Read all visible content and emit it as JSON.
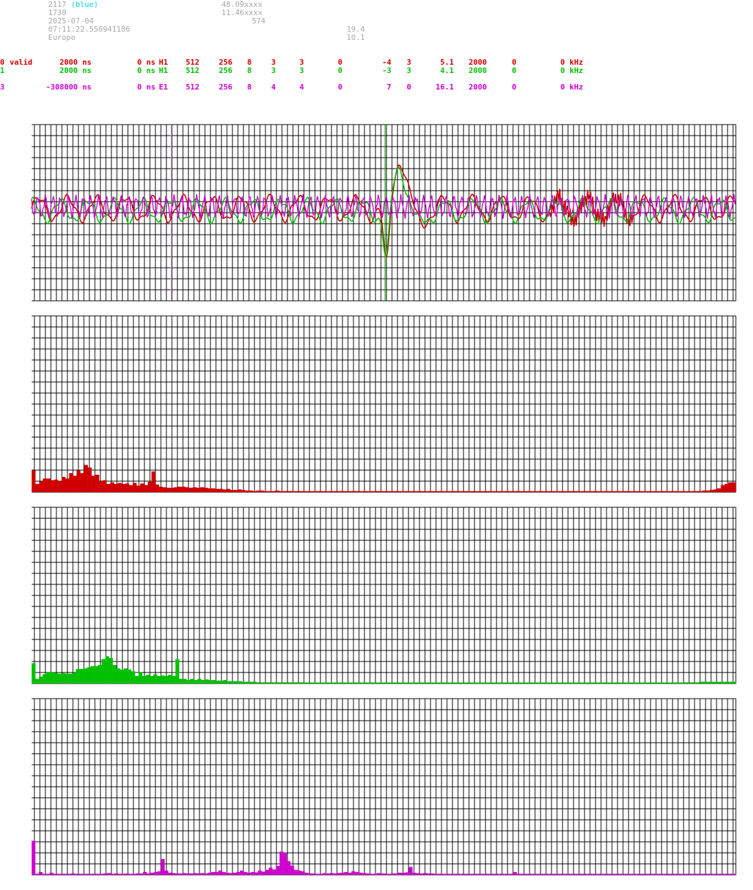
{
  "header": {
    "station_id": "2117",
    "station_color": "(blue)",
    "line2": "1730",
    "date": "2025-07-04",
    "time": "07:11:22.556941186",
    "region": "Europe",
    "lat": "48.09xxxx",
    "lon": "11.46xxxx",
    "alt": "574",
    "val1": "19.4",
    "val2": "10.1"
  },
  "channels": [
    {
      "id": "0",
      "flag": "valid",
      "offset": "2000 ns",
      "delay": "0 ns",
      "type": "H1",
      "c1": "512",
      "c2": "256",
      "c3": "8",
      "c4": "3",
      "c5": "3",
      "c6": "0",
      "c7": "-4",
      "c8": "3",
      "c9": "5.1",
      "c10": "2000",
      "c11": "0",
      "freq": "0 kHz",
      "color": "#d00000"
    },
    {
      "id": "1",
      "flag": "",
      "offset": "2000 ns",
      "delay": "0 ns",
      "type": "H1",
      "c1": "512",
      "c2": "256",
      "c3": "8",
      "c4": "3",
      "c5": "3",
      "c6": "0",
      "c7": "-3",
      "c8": "3",
      "c9": "4.1",
      "c10": "2000",
      "c11": "0",
      "freq": "0 kHz",
      "color": "#00c000"
    },
    {
      "id": "3",
      "flag": "",
      "offset": "-308000 ns",
      "delay": "0 ns",
      "type": "E1",
      "c1": "512",
      "c2": "256",
      "c3": "8",
      "c4": "4",
      "c5": "4",
      "c6": "0",
      "c7": "7",
      "c8": "0",
      "c9": "16.1",
      "c10": "2000",
      "c11": "0",
      "freq": "0 kHz",
      "color": "#d000d0"
    }
  ],
  "chart_data": [
    {
      "type": "line",
      "series": [
        {
          "color": "#d00000",
          "baseline": 0.0,
          "amp": 0.55,
          "period": 42,
          "pulse": [
            0,
            -3.2,
            2.6
          ]
        },
        {
          "color": "#00c000",
          "baseline": -0.1,
          "amp": 0.5,
          "period": 40,
          "pulse": [
            0,
            -2.6,
            2.2
          ]
        },
        {
          "color": "#d000d0",
          "baseline": 0.1,
          "amp": 0.45,
          "period": 11,
          "pulse": [
            0,
            0,
            0
          ]
        }
      ],
      "marker_lines": [
        {
          "color": "#f0c0f0",
          "at": 0.195
        },
        {
          "color": "#00a000",
          "at": 0.5
        }
      ]
    },
    {
      "type": "bar",
      "color": "#d00000",
      "values": [
        4,
        1.5,
        2,
        2.5,
        2.5,
        2.2,
        2.3,
        2,
        2.8,
        2.5,
        3.5,
        3,
        4,
        3.5,
        5,
        4.5,
        3,
        3.2,
        2,
        2.2,
        1.5,
        1.8,
        1.5,
        1.7,
        1.5,
        1.6,
        1.3,
        1.7,
        1.2,
        1.6,
        1.3,
        1.9,
        3.8,
        1.4,
        1.0,
        0.9,
        0.8,
        0.8,
        0.9,
        1.0,
        1.0,
        0.9,
        0.8,
        0.9,
        0.8,
        0.9,
        0.8,
        0.7,
        0.7,
        0.6,
        0.6,
        0.5,
        0.6,
        0.4,
        0.4,
        0.5,
        0.4,
        0.3,
        0.3,
        0.2,
        0.3,
        0.3,
        0.2,
        0.2,
        0.2,
        0.3,
        0.2,
        0.2,
        0.2,
        0.2,
        0.1,
        0.2,
        0.2,
        0.1,
        0.1,
        0.1,
        0.2,
        0.1,
        0.1,
        0.1,
        0.2,
        0.2,
        0.1,
        0.1,
        0.1,
        0.1,
        0.2,
        0.1,
        0.1,
        0.1,
        0.1,
        0.1,
        0.2,
        0.1,
        0.1,
        0.1,
        0.1,
        0.2,
        0.1,
        0.1,
        0.1,
        0.1,
        0.1,
        0.2,
        0.1,
        0.1,
        0.1,
        0.1,
        0.1,
        0.1,
        0.1,
        0.1,
        0.1,
        0.2,
        0.1,
        0.1,
        0.1,
        0.1,
        0.1,
        0.1,
        0.1,
        0.1,
        0.1,
        0.1,
        0.1,
        0.1,
        0.1,
        0.1,
        0.1,
        0.2,
        0.1,
        0.1,
        0.1,
        0.1,
        0.1,
        0.1,
        0.1,
        0.1,
        0.1,
        0.1,
        0.1,
        0.1,
        0.1,
        0.1,
        0.2,
        0.1,
        0.1,
        0.1,
        0.1,
        0.1,
        0.1,
        0.1,
        0.1,
        0.1,
        0.1,
        0.1,
        0.1,
        0.1,
        0.1,
        0.1,
        0.1,
        0.1,
        0.1,
        0.1,
        0.1,
        0.1,
        0.1,
        0.1,
        0.2,
        0.1,
        0.1,
        0.1,
        0.1,
        0.1,
        0.1,
        0.1,
        0.2,
        0.2,
        0.2,
        0.3,
        0.3,
        0.4,
        0.5,
        0.7,
        1.3,
        1.5,
        1.8,
        1.8
      ],
      "peak_value": 5,
      "peak_index": 14
    },
    {
      "type": "bar",
      "color": "#00c000",
      "values": [
        3.5,
        0.8,
        1.2,
        1.6,
        2,
        2,
        1.8,
        1.7,
        1.8,
        1.7,
        1.7,
        1.8,
        2.5,
        2.5,
        2.6,
        2.8,
        3,
        3,
        3.2,
        4.2,
        4.7,
        4.4,
        3.2,
        2.6,
        2.4,
        2.6,
        2.4,
        2.1,
        1.3,
        2.0,
        1.3,
        1.5,
        1.3,
        1.6,
        1.3,
        1.4,
        1.3,
        1.5,
        1.3,
        4.2,
        0.8,
        0.8,
        0.6,
        0.8,
        0.6,
        0.8,
        0.6,
        0.7,
        0.6,
        0.6,
        0.5,
        0.5,
        0.6,
        0.4,
        0.4,
        0.4,
        0.4,
        0.3,
        0.3,
        0.3,
        0.3,
        0.2,
        0.2,
        0.2,
        0.2,
        0.2,
        0.2,
        0.2,
        0.2,
        0.2,
        0.2,
        0.2,
        0.2,
        0.2,
        0.1,
        0.1,
        0.1,
        0.1,
        0.1,
        0.1,
        0.1,
        0.1,
        0.1,
        0.1,
        0.1,
        0.1,
        0.1,
        0.1,
        0.1,
        0.1,
        0.1,
        0.1,
        0.1,
        0.1,
        0.1,
        0.1,
        0.1,
        0.1,
        0.1,
        0.1,
        0.1,
        0.1,
        0.1,
        0.1,
        0.1,
        0.1,
        0.1,
        0.1,
        0.1,
        0.1,
        0.1,
        0.1,
        0.1,
        0.1,
        0.1,
        0.1,
        0.1,
        0.1,
        0.1,
        0.1,
        0.1,
        0.1,
        0.1,
        0.1,
        0.1,
        0.1,
        0.1,
        0.1,
        0.1,
        0.1,
        0.1,
        0.1,
        0.1,
        0.1,
        0.1,
        0.1,
        0.1,
        0.1,
        0.1,
        0.1,
        0.1,
        0.1,
        0.1,
        0.1,
        0.1,
        0.1,
        0.1,
        0.1,
        0.1,
        0.1,
        0.1,
        0.1,
        0.1,
        0.1,
        0.1,
        0.1,
        0.1,
        0.1,
        0.1,
        0.1,
        0.1,
        0.1,
        0.1,
        0.1,
        0.1,
        0.1,
        0.1,
        0.1,
        0.1,
        0.1,
        0.1,
        0.1,
        0.1,
        0.1,
        0.1,
        0.1,
        0.1,
        0.2,
        0.2,
        0.2,
        0.2,
        0.3,
        0.3,
        0.3,
        0.3,
        0.3,
        0.3,
        0.3,
        0.3,
        0.3,
        0.3
      ]
    },
    {
      "type": "bar",
      "color": "#d000d0",
      "values": [
        9.5,
        0.3,
        0.8,
        0.3,
        0.3,
        0.6,
        0.3,
        0.3,
        0.3,
        0.3,
        0.3,
        0.4,
        0.3,
        0.3,
        0.3,
        0.3,
        0.3,
        0.3,
        0.3,
        0.3,
        0.4,
        0.5,
        0.3,
        0.4,
        0.3,
        0.3,
        0.4,
        0.3,
        0.3,
        0.4,
        0.4,
        0.8,
        0.4,
        0.6,
        0.8,
        1.0,
        4.4,
        1.2,
        0.6,
        0.5,
        0.4,
        0.4,
        0.5,
        0.4,
        0.4,
        0.5,
        0.4,
        0.5,
        0.4,
        0.6,
        0.8,
        0.8,
        1.2,
        0.8,
        0.6,
        0.5,
        0.6,
        0.8,
        1.2,
        0.8,
        0.6,
        0.8,
        0.7,
        1.2,
        0.9,
        1.4,
        2,
        1.5,
        2.5,
        6.5,
        6.2,
        3.8,
        2.6,
        1.4,
        1.2,
        1.0,
        0.6,
        0.4,
        0.4,
        0.3,
        0.3,
        0.5,
        0.4,
        0.5,
        0.4,
        0.5,
        0.6,
        0.8,
        0.6,
        1.0,
        0.8,
        0.6,
        0.5,
        0.4,
        0.3,
        0.3,
        0.5,
        0.4,
        0.4,
        0.3,
        0.4,
        0.4,
        0.6,
        0.6,
        0.7,
        2.2,
        0.6,
        0.5,
        0.4,
        0.5,
        0.4,
        0.4,
        0.3,
        0.3,
        0.3,
        0.3,
        0.3,
        0.3,
        0.3,
        0.3,
        0.3,
        0.3,
        0.3,
        0.3,
        0.3,
        0.3,
        0.3,
        0.3,
        0.3,
        0.3,
        0.3,
        0.3,
        0.3,
        0.3,
        0.8,
        0.3,
        0.3,
        0.3,
        0.3,
        0.3,
        0.3,
        0.3,
        0.3,
        0.3,
        0.3,
        0.3,
        0.3,
        0.3,
        0.3,
        0.3,
        0.3,
        0.3,
        0.3,
        0.3,
        0.3,
        0.3,
        0.3,
        0.3,
        0.3,
        0.3,
        0.3,
        0.3,
        0.3,
        0.3,
        0.3,
        0.3,
        0.3,
        0.3,
        0.3,
        0.3,
        0.3,
        0.3,
        0.3,
        0.3,
        0.3,
        0.3,
        0.3,
        0.3,
        0.3,
        0.3,
        0.3,
        0.3,
        0.3,
        0.3,
        0.3,
        0.3,
        0.3,
        0.3,
        0.3,
        0.3,
        0.3,
        0.3,
        0.3,
        0.3,
        0.3,
        0.3
      ]
    }
  ]
}
